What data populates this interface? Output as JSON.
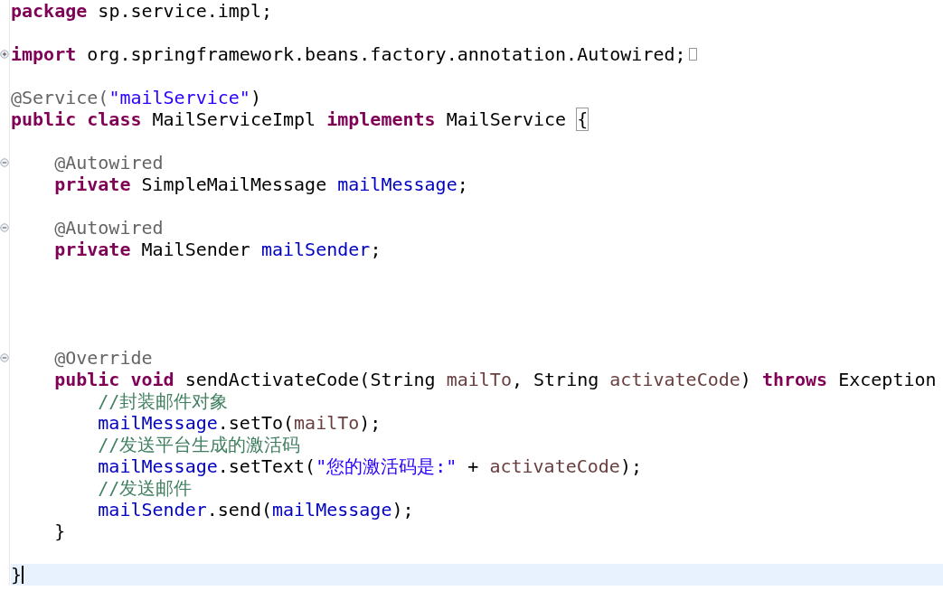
{
  "editor": {
    "lines": [
      {
        "kind": "code",
        "tokens": [
          {
            "text": "package",
            "kind": "keyword"
          },
          {
            "text": " sp.service.impl;",
            "kind": "plain"
          }
        ]
      },
      {
        "kind": "blank"
      },
      {
        "kind": "code",
        "fold": {
          "collapsed": true
        },
        "folded_marker": true,
        "tokens": [
          {
            "text": "import",
            "kind": "keyword"
          },
          {
            "text": " org.springframework.beans.factory.annotation.Autowired;",
            "kind": "plain"
          }
        ]
      },
      {
        "kind": "blank"
      },
      {
        "kind": "code",
        "tokens": [
          {
            "text": "@Service(",
            "kind": "annotation"
          },
          {
            "text": "\"mailService\"",
            "kind": "string"
          },
          {
            "text": ")",
            "kind": "plain"
          }
        ]
      },
      {
        "kind": "code",
        "tokens": [
          {
            "text": "public",
            "kind": "keyword"
          },
          {
            "text": " class",
            "kind": "keyword"
          },
          {
            "text": " MailServiceImpl ",
            "kind": "plain"
          },
          {
            "text": "implements",
            "kind": "keyword"
          },
          {
            "text": " MailService ",
            "kind": "plain"
          },
          {
            "text": "{",
            "kind": "bracket"
          }
        ]
      },
      {
        "kind": "blank"
      },
      {
        "kind": "code",
        "fold": {
          "collapsed": false
        },
        "tokens": [
          {
            "text": "    @Autowired",
            "kind": "annotation"
          }
        ]
      },
      {
        "kind": "code",
        "tokens": [
          {
            "text": "    private",
            "kind": "keyword"
          },
          {
            "text": " SimpleMailMessage ",
            "kind": "plain"
          },
          {
            "text": "mailMessage",
            "kind": "field"
          },
          {
            "text": ";",
            "kind": "plain"
          }
        ]
      },
      {
        "kind": "blank"
      },
      {
        "kind": "code",
        "fold": {
          "collapsed": false
        },
        "tokens": [
          {
            "text": "    @Autowired",
            "kind": "annotation"
          }
        ]
      },
      {
        "kind": "code",
        "tokens": [
          {
            "text": "    private",
            "kind": "keyword"
          },
          {
            "text": " MailSender ",
            "kind": "plain"
          },
          {
            "text": "mailSender",
            "kind": "field"
          },
          {
            "text": ";",
            "kind": "plain"
          }
        ]
      },
      {
        "kind": "blank"
      },
      {
        "kind": "blank"
      },
      {
        "kind": "blank"
      },
      {
        "kind": "blank"
      },
      {
        "kind": "code",
        "fold": {
          "collapsed": false
        },
        "tokens": [
          {
            "text": "    @Override",
            "kind": "annotation"
          }
        ]
      },
      {
        "kind": "code",
        "tokens": [
          {
            "text": "    public",
            "kind": "keyword"
          },
          {
            "text": " void",
            "kind": "keyword"
          },
          {
            "text": " sendActivateCode(String ",
            "kind": "plain"
          },
          {
            "text": "mailTo",
            "kind": "param"
          },
          {
            "text": ", String ",
            "kind": "plain"
          },
          {
            "text": "activateCode",
            "kind": "param"
          },
          {
            "text": ") ",
            "kind": "plain"
          },
          {
            "text": "throws",
            "kind": "keyword"
          },
          {
            "text": " Exception",
            "kind": "plain"
          }
        ]
      },
      {
        "kind": "code",
        "tokens": [
          {
            "text": "        //封装邮件对象",
            "kind": "comment"
          }
        ]
      },
      {
        "kind": "code",
        "tokens": [
          {
            "text": "        mailMessage",
            "kind": "field"
          },
          {
            "text": ".setTo(",
            "kind": "plain"
          },
          {
            "text": "mailTo",
            "kind": "param"
          },
          {
            "text": ");",
            "kind": "plain"
          }
        ]
      },
      {
        "kind": "code",
        "tokens": [
          {
            "text": "        //发送平台生成的激活码",
            "kind": "comment"
          }
        ]
      },
      {
        "kind": "code",
        "tokens": [
          {
            "text": "        mailMessage",
            "kind": "field"
          },
          {
            "text": ".setText(",
            "kind": "plain"
          },
          {
            "text": "\"您的激活码是:\"",
            "kind": "string"
          },
          {
            "text": " + ",
            "kind": "plain"
          },
          {
            "text": "activateCode",
            "kind": "param"
          },
          {
            "text": ");",
            "kind": "plain"
          }
        ]
      },
      {
        "kind": "code",
        "tokens": [
          {
            "text": "        //发送邮件",
            "kind": "comment"
          }
        ]
      },
      {
        "kind": "code",
        "tokens": [
          {
            "text": "        mailSender",
            "kind": "field"
          },
          {
            "text": ".send(",
            "kind": "plain"
          },
          {
            "text": "mailMessage",
            "kind": "field"
          },
          {
            "text": ");",
            "kind": "plain"
          }
        ]
      },
      {
        "kind": "code",
        "tokens": [
          {
            "text": "    }",
            "kind": "plain"
          }
        ]
      },
      {
        "kind": "blank"
      },
      {
        "kind": "code",
        "current": true,
        "tokens": [
          {
            "text": "}",
            "kind": "plain"
          }
        ]
      }
    ]
  }
}
